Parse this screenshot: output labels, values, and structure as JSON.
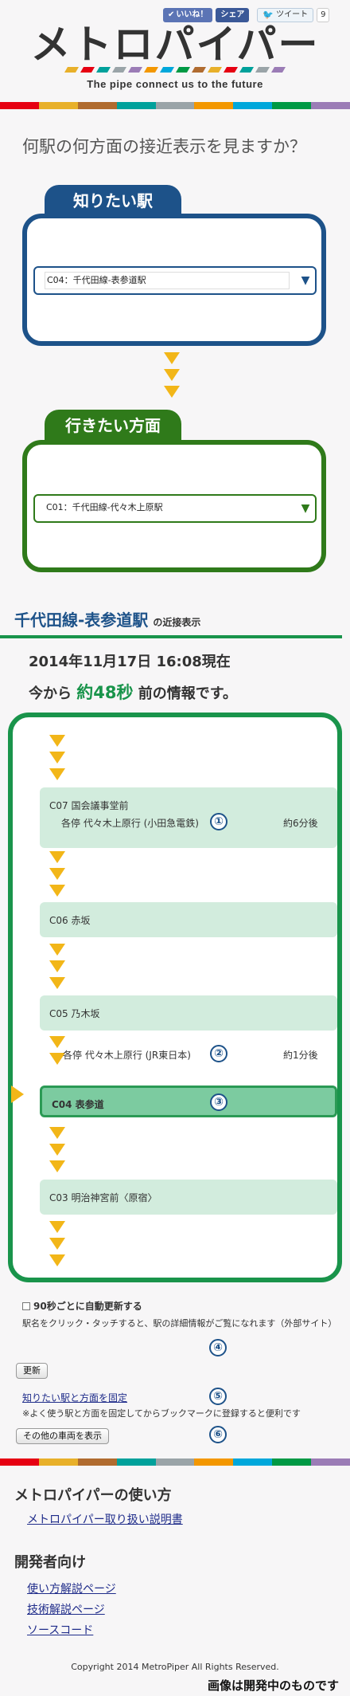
{
  "social": {
    "like": "いいね！",
    "share": "シェア",
    "tweet": "ツイート",
    "tweet_count": "9"
  },
  "logo": {
    "title": "メトロパイパー",
    "tagline": "The pipe connect us to the future"
  },
  "colors": {
    "stripe": [
      "#e60012",
      "#e8b02a",
      "#b06b2f",
      "#00a19b",
      "#9aa4a8",
      "#f39700",
      "#00a7db",
      "#009944",
      "#9b7cb6"
    ],
    "origin": "#1d5289",
    "destination": "#2f7a1a",
    "route": "#19944b",
    "arrow": "#f2b618"
  },
  "question": "何駅の何方面の接近表示を見ますか？",
  "origin": {
    "tab": "知りたい駅",
    "value": "C04：千代田線-表参道駅"
  },
  "destination": {
    "tab": "行きたい方面",
    "value": "C01：千代田線-代々木上原駅"
  },
  "result": {
    "station": "千代田線-表参道駅",
    "suffix": "の近接表示",
    "timestamp": "2014年11月17日 16:08現在",
    "ago_prefix": "今から",
    "ago_value": "約48秒",
    "ago_suffix": "前の情報です。"
  },
  "stations": [
    {
      "name": "C07 国会議事堂前",
      "train": "各停 代々木上原行 (小田急電鉄)",
      "eta": "約6分後",
      "marker": "①"
    },
    {
      "name": "C06 赤坂"
    },
    {
      "name": "C05 乃木坂"
    },
    {
      "between": true,
      "train": "各停 代々木上原行 (JR東日本)",
      "eta": "約1分後",
      "marker": "②"
    },
    {
      "name": "C04 表参道",
      "current": true,
      "marker": "③"
    },
    {
      "name": "C03 明治神宮前〈原宿〉"
    }
  ],
  "controls": {
    "auto_update": "90秒ごとに自動更新する",
    "hint": "駅名をクリック・タッチすると、駅の詳細情報がご覧になれます（外部サイト）",
    "hint_marker": "④",
    "update_button": "更新",
    "fix_link": "知りたい駅と方面を固定",
    "fix_marker": "⑤",
    "fix_note": "※よく使う駅と方面を固定してからブックマークに登録すると便利です",
    "other_trains_button": "その他の車両を表示",
    "other_marker": "⑥"
  },
  "footer": {
    "usage_title": "メトロパイパーの使い方",
    "usage_link": "メトロパイパー取り扱い説明書",
    "dev_title": "開発者向け",
    "dev_links": [
      "使い方解説ページ",
      "技術解説ページ",
      "ソースコード"
    ],
    "copyright": "Copyright 2014 MetroPiper All Rights Reserved.",
    "dev_note": "画像は開発中のものです"
  }
}
